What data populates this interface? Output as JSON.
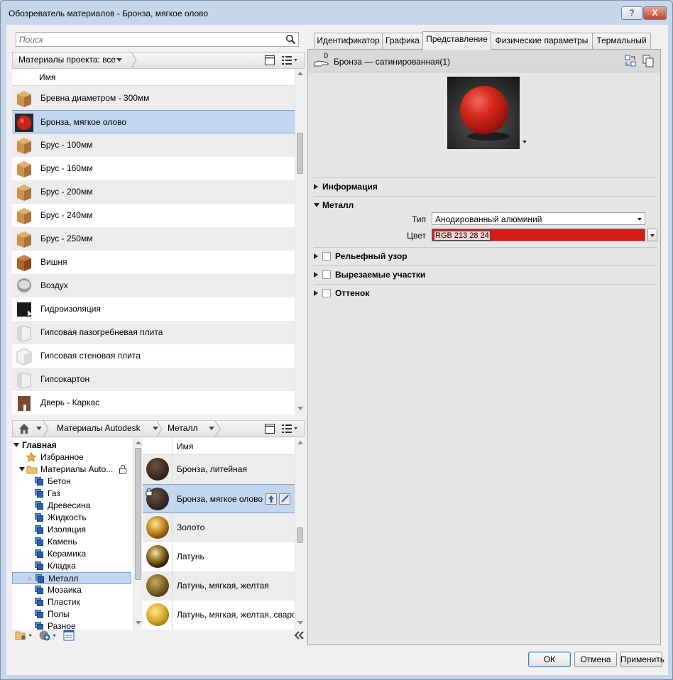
{
  "window": {
    "title": "Обозреватель материалов - Бронза, мягкое олово",
    "help_label": "?",
    "close_label": "X"
  },
  "project": {
    "search_placeholder": "Поиск",
    "filter_label": "Материалы проекта: все",
    "column_header": "Имя",
    "materials": [
      {
        "label": "Бревна диаметром - 300мм",
        "icon": "wood-icon"
      },
      {
        "label": "Бронза, мягкое олово",
        "icon": "red-sphere-icon"
      },
      {
        "label": "Брус - 100мм",
        "icon": "wood-icon"
      },
      {
        "label": "Брус - 160мм",
        "icon": "wood-icon"
      },
      {
        "label": "Брус - 200мм",
        "icon": "wood-icon"
      },
      {
        "label": "Брус - 240мм",
        "icon": "wood-icon"
      },
      {
        "label": "Брус - 250мм",
        "icon": "wood-icon"
      },
      {
        "label": "Вишня",
        "icon": "cherry-wood-icon"
      },
      {
        "label": "Воздух",
        "icon": "air-icon"
      },
      {
        "label": "Гидроизоляция",
        "icon": "black-membrane-icon"
      },
      {
        "label": "Гипсовая пазогребневая плита",
        "icon": "white-block-icon"
      },
      {
        "label": "Гипсовая стеновая плита",
        "icon": "white-block-icon"
      },
      {
        "label": "Гипсокартон",
        "icon": "white-block-icon"
      },
      {
        "label": "Дверь - Каркас",
        "icon": "door-frame-icon"
      }
    ]
  },
  "library": {
    "home_icon": "home-icon",
    "crumb1": "Материалы Autodesk",
    "crumb2": "Металл",
    "column_header": "Имя",
    "tree_root": "Главная",
    "tree_favorites": "Избранное",
    "tree_library": "Материалы Auto...",
    "categories": [
      "Бетон",
      "Газ",
      "Древесина",
      "Жидкость",
      "Изоляция",
      "Камень",
      "Керамика",
      "Кладка",
      "Металл",
      "Мозаика",
      "Пластик",
      "Полы",
      "Разное"
    ],
    "items": [
      {
        "label": "Бронза, литейная",
        "color": "#3a2b22"
      },
      {
        "label": "Бронза, мягкое олово",
        "color": "#3d2c22"
      },
      {
        "label": "Золото",
        "color": "#b87a1c"
      },
      {
        "label": "Латунь",
        "color": "#6b5418"
      },
      {
        "label": "Латунь, мягкая, желтая",
        "color": "#7a6422"
      },
      {
        "label": "Латунь, мягкая, желтая, сваро",
        "color": "#c89a20"
      }
    ]
  },
  "editor": {
    "tabs": [
      "Идентификатор",
      "Графика",
      "Представление",
      "Физические параметры",
      "Термальный"
    ],
    "active_tab": "Представление",
    "usage_count": "0",
    "asset_name": "Бронза — сатинированная(1)",
    "section_info": "Информация",
    "section_metal": "Металл",
    "type_label": "Тип",
    "type_value": "Анодированный алюминий",
    "color_label": "Цвет",
    "color_value": "RGB 213 28 24",
    "color_hex": "#d51c18",
    "section_relief": "Рельефный узор",
    "section_cutouts": "Вырезаемые участки",
    "section_tint": "Оттенок"
  },
  "buttons": {
    "ok": "ОК",
    "cancel": "Отмена",
    "apply": "Применить"
  }
}
